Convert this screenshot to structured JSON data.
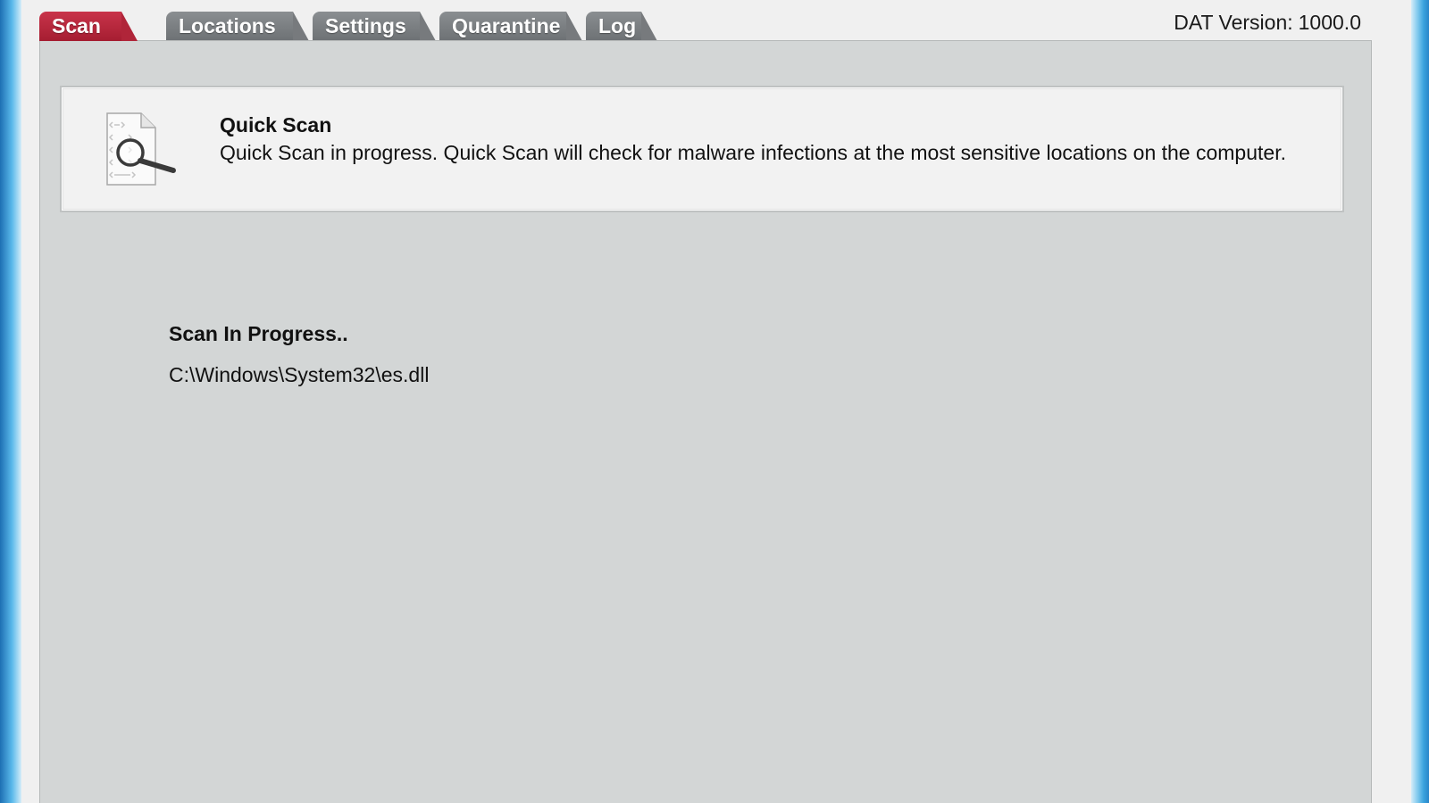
{
  "tabs": [
    {
      "label": "Scan",
      "active": true
    },
    {
      "label": "Locations",
      "active": false
    },
    {
      "label": "Settings",
      "active": false
    },
    {
      "label": "Quarantine",
      "active": false
    },
    {
      "label": "Log",
      "active": false
    }
  ],
  "dat": {
    "label": "DAT Version:",
    "value": "1000.0"
  },
  "scan_info": {
    "icon": "document-magnifier-icon",
    "title": "Quick Scan",
    "description": "Quick Scan in progress. Quick Scan will check for malware infections at the most sensitive locations on the computer."
  },
  "progress": {
    "status": "Scan In Progress..",
    "current_file": "C:\\Windows\\System32\\es.dll"
  },
  "colors": {
    "active_tab": "#b52539",
    "inactive_tab": "#777a7d",
    "panel_bg": "#d3d6d6",
    "info_bg": "#f2f2f2"
  }
}
